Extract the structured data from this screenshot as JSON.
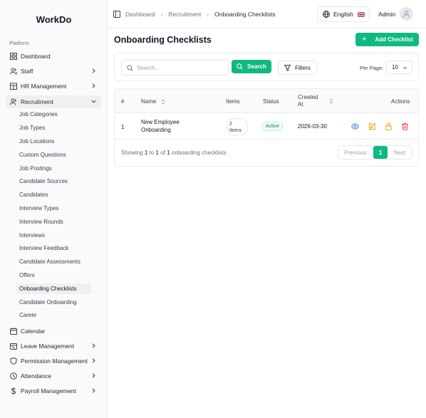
{
  "app": {
    "logo": "WorkDo"
  },
  "sidebar": {
    "section_label": "Platform",
    "items": [
      {
        "label": "Dashboard",
        "icon": "grid-icon",
        "has_chevron": false
      },
      {
        "label": "Staff",
        "icon": "users-icon",
        "has_chevron": true
      },
      {
        "label": "HR Management",
        "icon": "building-icon",
        "has_chevron": true
      },
      {
        "label": "Recruitment",
        "icon": "user-plus-icon",
        "has_chevron": true,
        "expanded": true
      },
      {
        "label": "Calendar",
        "icon": "calendar-icon",
        "has_chevron": false
      },
      {
        "label": "Leave Management",
        "icon": "calendar-off-icon",
        "has_chevron": true
      },
      {
        "label": "Permission Management",
        "icon": "shield-icon",
        "has_chevron": true
      },
      {
        "label": "Attendance",
        "icon": "clock-icon",
        "has_chevron": true
      },
      {
        "label": "Payroll Management",
        "icon": "dollar-icon",
        "has_chevron": true
      }
    ],
    "recruitment_subitems": [
      "Job Categories",
      "Job Types",
      "Job Locations",
      "Custom Questions",
      "Job Postings",
      "Candidate Sources",
      "Candidates",
      "Interview Types",
      "Interview Rounds",
      "Interviews",
      "Interview Feedback",
      "Candidate Assessments",
      "Offers",
      "Onboarding Checklists",
      "Candidate Onboarding",
      "Career"
    ],
    "active_subitem": "Onboarding Checklists"
  },
  "topbar": {
    "breadcrumb": [
      "Dashboard",
      "Recruitment",
      "Onboarding Checklists"
    ],
    "language": "English",
    "user": "Admin"
  },
  "page": {
    "title": "Onboarding Checklists",
    "add_button": "Add Checklist"
  },
  "filters": {
    "search_placeholder": "Search...",
    "search_button": "Search",
    "filters_button": "Filters",
    "per_page_label": "Per Page:",
    "per_page_value": "10"
  },
  "table": {
    "headers": {
      "num": "#",
      "name": "Name",
      "items": "Items",
      "status": "Status",
      "created_line1": "Created",
      "created_line2": "At",
      "actions": "Actions"
    },
    "rows": [
      {
        "num": "1",
        "name_line1": "New Employee",
        "name_line2": "Onboarding",
        "items_line1": "2",
        "items_line2": "Items",
        "status": "Active",
        "created": "2026-03-30"
      }
    ],
    "footer": {
      "showing": "Showing",
      "from": "1",
      "to_word": "to",
      "to": "1",
      "of_word": "of",
      "total": "1",
      "suffix": "onboarding checklists"
    },
    "pagination": {
      "prev": "Previous",
      "current": "1",
      "next": "Next"
    }
  },
  "colors": {
    "accent": "#10b981",
    "danger": "#ef4444",
    "warning": "#f59e0b",
    "info": "#3b82f6"
  }
}
